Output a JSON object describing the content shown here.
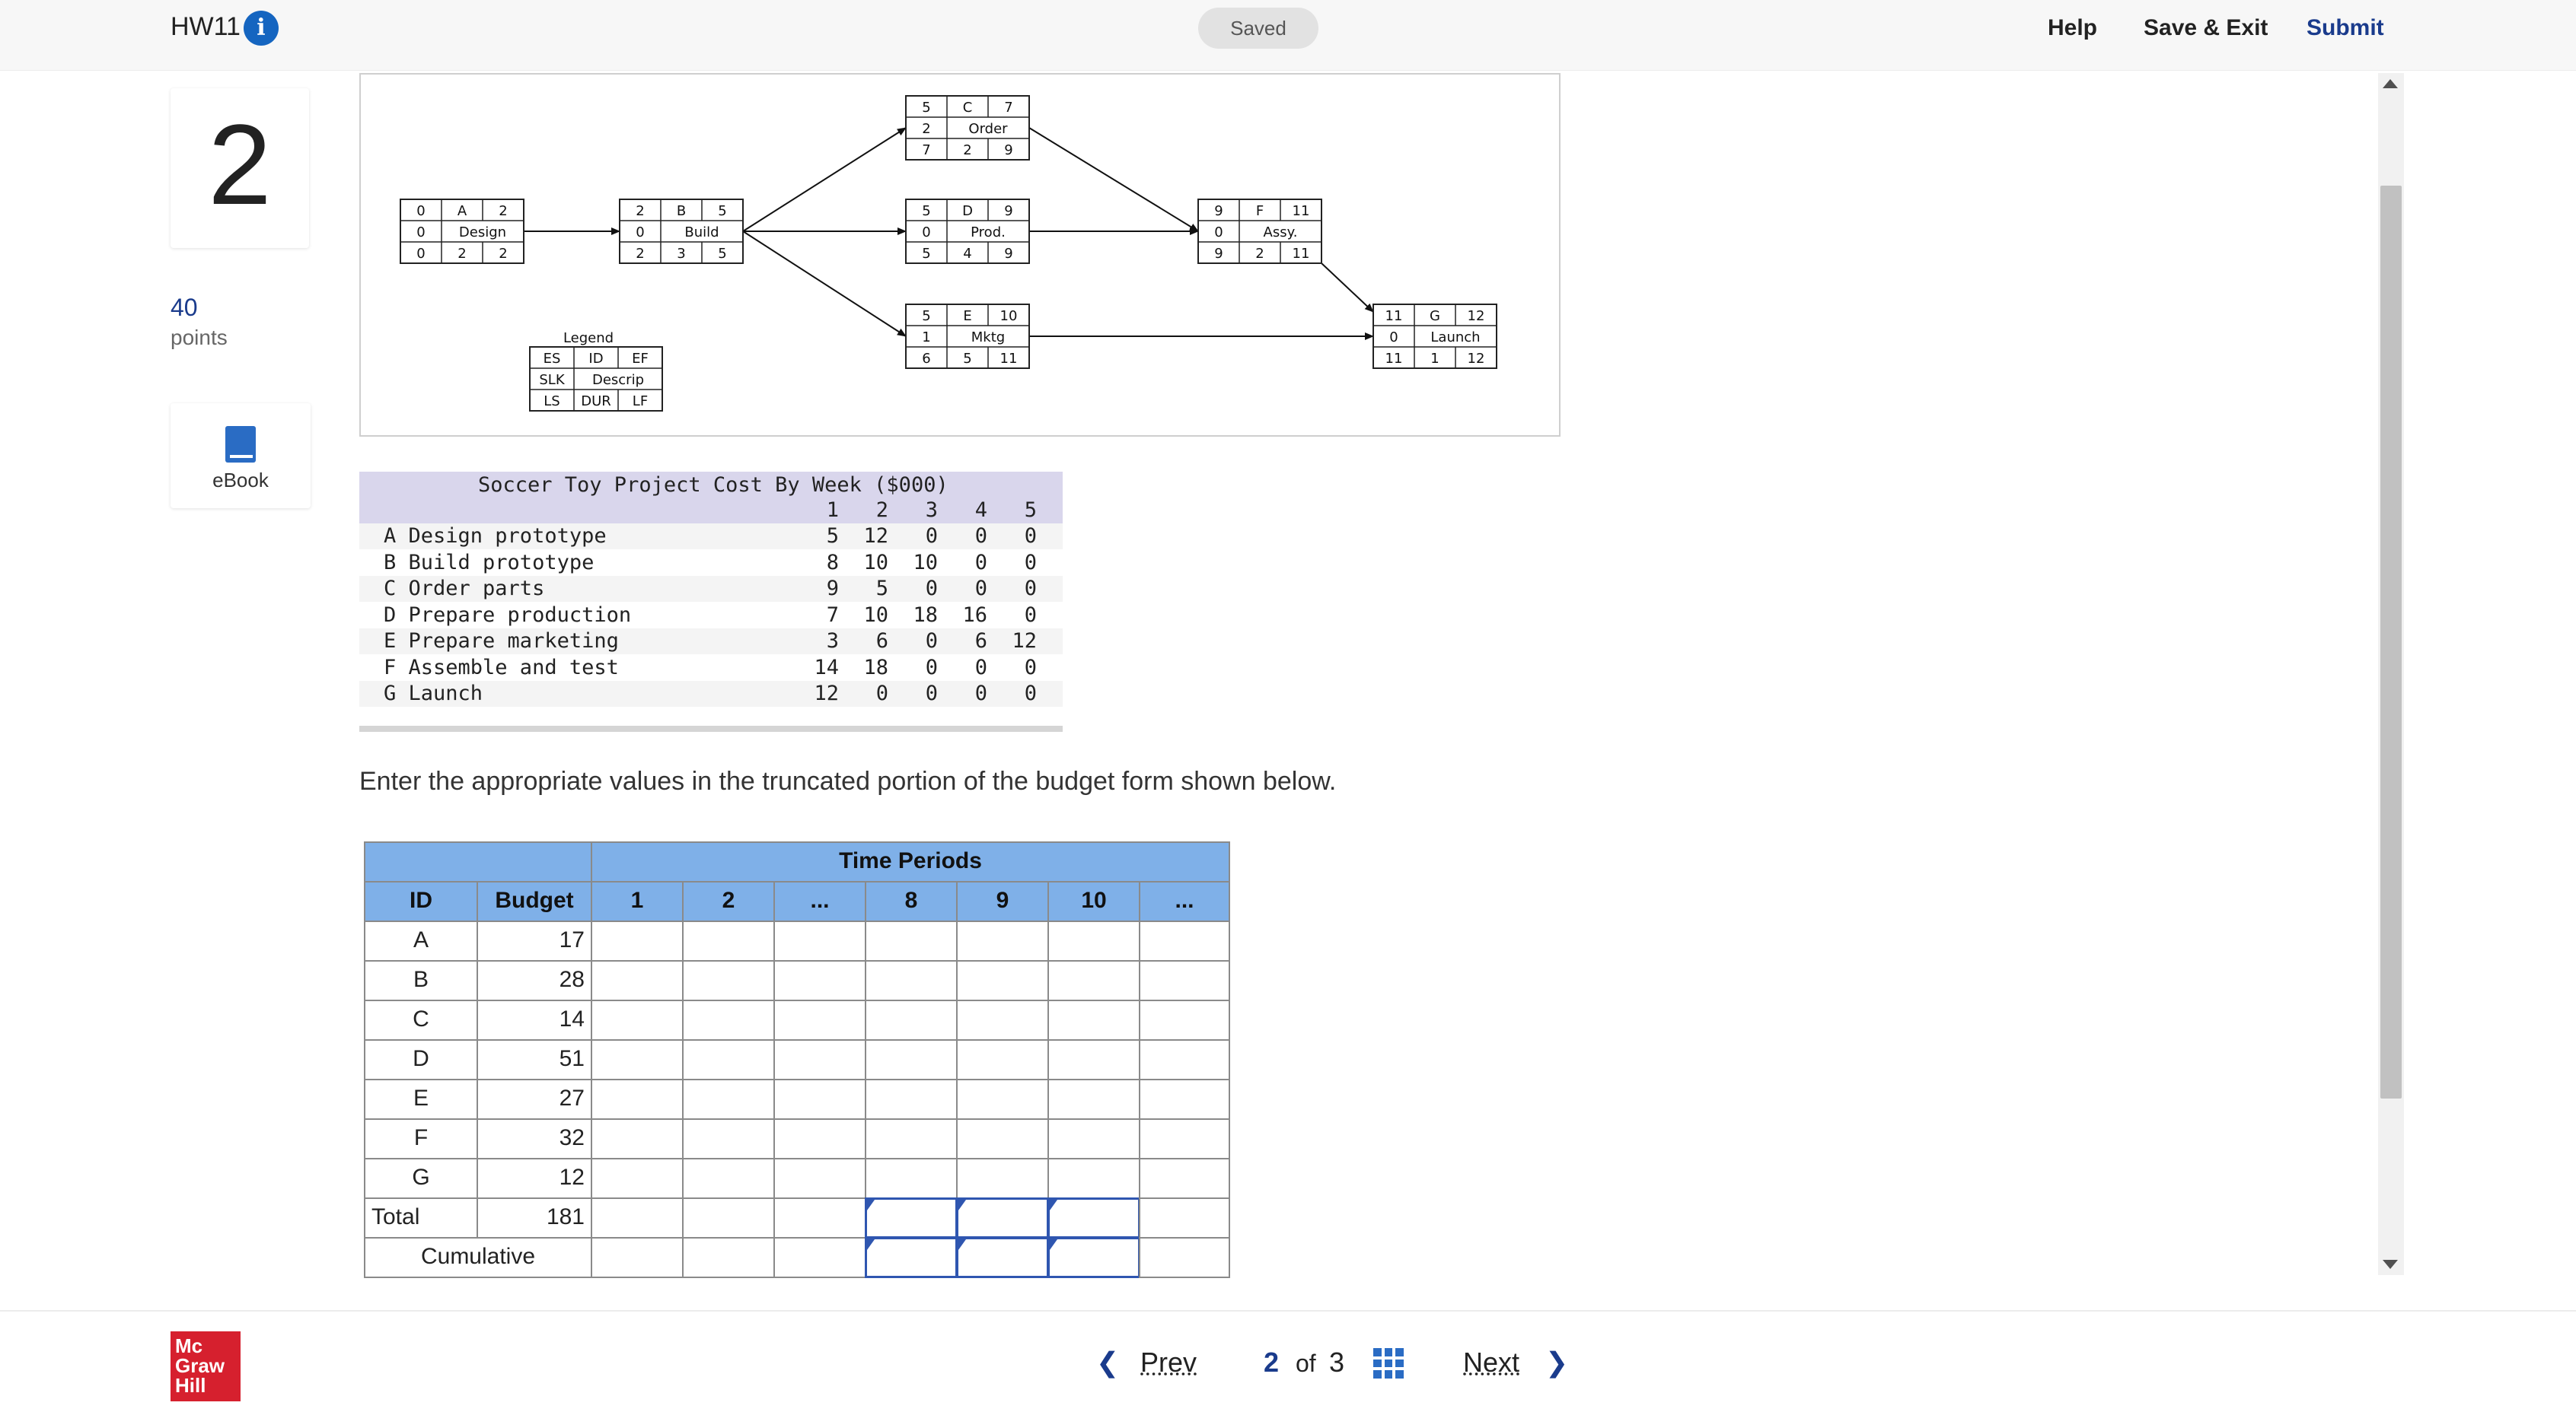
{
  "topbar": {
    "title": "HW11",
    "info_icon": "info-icon",
    "status": "Saved",
    "help": "Help",
    "save_exit": "Save & Exit",
    "submit": "Submit"
  },
  "question": {
    "number": "2",
    "points": "40",
    "points_label": "points",
    "ebook_label": "eBook"
  },
  "network": {
    "nodes": [
      {
        "id": "A",
        "es": "0",
        "ef": "2",
        "slk": "0",
        "desc": "Design",
        "ls": "0",
        "dur": "2",
        "lf": "2"
      },
      {
        "id": "B",
        "es": "2",
        "ef": "5",
        "slk": "0",
        "desc": "Build",
        "ls": "2",
        "dur": "3",
        "lf": "5"
      },
      {
        "id": "C",
        "es": "5",
        "ef": "7",
        "slk": "2",
        "desc": "Order",
        "ls": "7",
        "dur": "2",
        "lf": "9"
      },
      {
        "id": "D",
        "es": "5",
        "ef": "9",
        "slk": "0",
        "desc": "Prod.",
        "ls": "5",
        "dur": "4",
        "lf": "9"
      },
      {
        "id": "E",
        "es": "5",
        "ef": "10",
        "slk": "1",
        "desc": "Mktg",
        "ls": "6",
        "dur": "5",
        "lf": "11"
      },
      {
        "id": "F",
        "es": "9",
        "ef": "11",
        "slk": "0",
        "desc": "Assy.",
        "ls": "9",
        "dur": "2",
        "lf": "11"
      },
      {
        "id": "G",
        "es": "11",
        "ef": "12",
        "slk": "0",
        "desc": "Launch",
        "ls": "11",
        "dur": "1",
        "lf": "12"
      }
    ],
    "legend": {
      "title": "Legend",
      "cells": [
        "ES",
        "ID",
        "EF",
        "SLK",
        "Descrip",
        "LS",
        "DUR",
        "LF"
      ]
    }
  },
  "cost_table": {
    "title": "Soccer Toy Project Cost By Week ($000)",
    "weeks": [
      "1",
      "2",
      "3",
      "4",
      "5"
    ],
    "rows": [
      {
        "name": "A Design prototype",
        "values": [
          "5",
          "12",
          "0",
          "0",
          "0"
        ]
      },
      {
        "name": "B Build prototype",
        "values": [
          "8",
          "10",
          "10",
          "0",
          "0"
        ]
      },
      {
        "name": "C Order parts",
        "values": [
          "9",
          "5",
          "0",
          "0",
          "0"
        ]
      },
      {
        "name": "D Prepare production",
        "values": [
          "7",
          "10",
          "18",
          "16",
          "0"
        ]
      },
      {
        "name": "E Prepare marketing",
        "values": [
          "3",
          "6",
          "0",
          "6",
          "12"
        ]
      },
      {
        "name": "F Assemble and test",
        "values": [
          "14",
          "18",
          "0",
          "0",
          "0"
        ]
      },
      {
        "name": "G Launch",
        "values": [
          "12",
          "0",
          "0",
          "0",
          "0"
        ]
      }
    ]
  },
  "instruction": "Enter the appropriate values in the truncated portion of the budget form shown below.",
  "budget_table": {
    "group_header": "Time Periods",
    "headers": [
      "ID",
      "Budget",
      "1",
      "2",
      "...",
      "8",
      "9",
      "10",
      "..."
    ],
    "rows": [
      {
        "id": "A",
        "budget": "17"
      },
      {
        "id": "B",
        "budget": "28"
      },
      {
        "id": "C",
        "budget": "14"
      },
      {
        "id": "D",
        "budget": "51"
      },
      {
        "id": "E",
        "budget": "27"
      },
      {
        "id": "F",
        "budget": "32"
      },
      {
        "id": "G",
        "budget": "12"
      }
    ],
    "total_label": "Total",
    "total_value": "181",
    "cumulative_label": "Cumulative"
  },
  "footer": {
    "logo": [
      "Mc",
      "Graw",
      "Hill"
    ],
    "prev": "Prev",
    "current_page": "2",
    "of": "of",
    "total_pages": "3",
    "next": "Next"
  }
}
